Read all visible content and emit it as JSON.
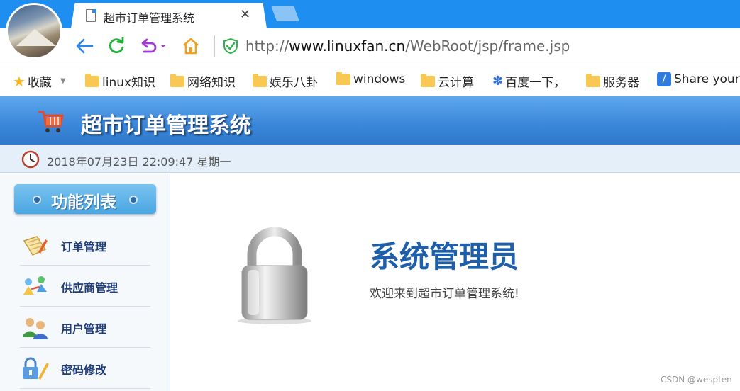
{
  "browser": {
    "tab_title": "超市订单管理系统",
    "tab_close": "✕",
    "url_prefix": "http://",
    "url_host": "www.linuxfan.cn",
    "url_path": "/WebRoot/jsp/frame.jsp"
  },
  "bookmarks": {
    "favorites": "收藏",
    "items": [
      "linux知识",
      "网络知识",
      "娱乐八卦",
      "windows",
      "云计算",
      "百度一下，",
      "服务器",
      "Share your"
    ]
  },
  "app": {
    "title": "超市订单管理系统",
    "datetime": "2018年07月23日 22:09:47 星期一"
  },
  "sidebar": {
    "title": "功能列表",
    "items": [
      {
        "label": "订单管理",
        "icon": "order-icon"
      },
      {
        "label": "供应商管理",
        "icon": "supplier-icon"
      },
      {
        "label": "用户管理",
        "icon": "users-icon"
      },
      {
        "label": "密码修改",
        "icon": "password-icon"
      }
    ]
  },
  "main": {
    "role_title": "系统管理员",
    "welcome": "欢迎来到超市订单管理系统!",
    "watermark": "CSDN @wespten"
  },
  "colors": {
    "browser_blue": "#1e8ff0",
    "header_blue": "#3a86d8",
    "title_blue": "#1d5fab"
  }
}
